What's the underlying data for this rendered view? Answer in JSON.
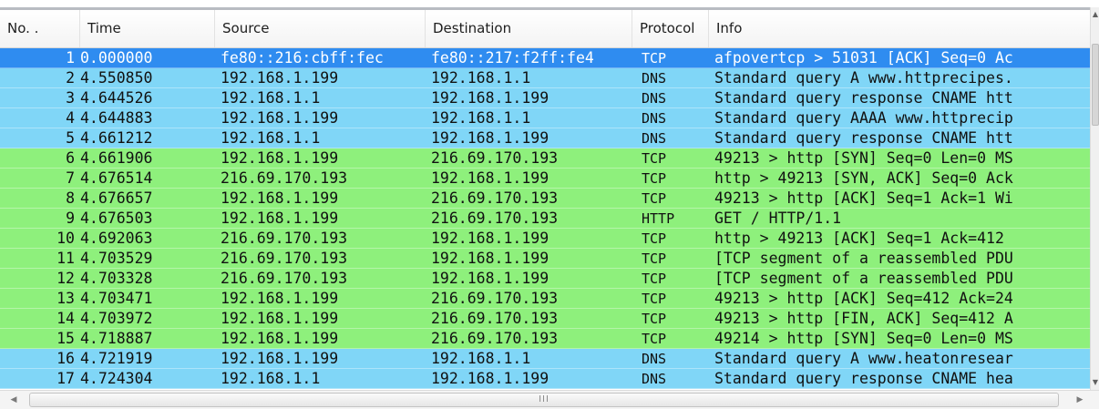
{
  "columns": {
    "no": "No. .",
    "time": "Time",
    "source": "Source",
    "destination": "Destination",
    "protocol": "Protocol",
    "info": "Info"
  },
  "colors": {
    "selected": "#2f8cf0",
    "dns": "#80d6f7",
    "tcp": "#8ef07c",
    "http": "#8ef07c"
  },
  "packets": [
    {
      "no": "1",
      "time": "0.000000",
      "source": "fe80::216:cbff:fec",
      "destination": "fe80::217:f2ff:fe4",
      "protocol": "TCP",
      "info": "afpovertcp > 51031 [ACK] Seq=0 Ac",
      "color": "selected",
      "selected": true
    },
    {
      "no": "2",
      "time": "4.550850",
      "source": "192.168.1.199",
      "destination": "192.168.1.1",
      "protocol": "DNS",
      "info": "Standard query A www.httprecipes.",
      "color": "dns"
    },
    {
      "no": "3",
      "time": "4.644526",
      "source": "192.168.1.1",
      "destination": "192.168.1.199",
      "protocol": "DNS",
      "info": "Standard query response CNAME htt",
      "color": "dns"
    },
    {
      "no": "4",
      "time": "4.644883",
      "source": "192.168.1.199",
      "destination": "192.168.1.1",
      "protocol": "DNS",
      "info": "Standard query AAAA www.httprecip",
      "color": "dns"
    },
    {
      "no": "5",
      "time": "4.661212",
      "source": "192.168.1.1",
      "destination": "192.168.1.199",
      "protocol": "DNS",
      "info": "Standard query response CNAME htt",
      "color": "dns"
    },
    {
      "no": "6",
      "time": "4.661906",
      "source": "192.168.1.199",
      "destination": "216.69.170.193",
      "protocol": "TCP",
      "info": "49213 > http [SYN] Seq=0 Len=0 MS",
      "color": "tcp"
    },
    {
      "no": "7",
      "time": "4.676514",
      "source": "216.69.170.193",
      "destination": "192.168.1.199",
      "protocol": "TCP",
      "info": "http > 49213 [SYN, ACK] Seq=0 Ack",
      "color": "tcp"
    },
    {
      "no": "8",
      "time": "4.676657",
      "source": "192.168.1.199",
      "destination": "216.69.170.193",
      "protocol": "TCP",
      "info": "49213 > http [ACK] Seq=1 Ack=1 Wi",
      "color": "tcp"
    },
    {
      "no": "9",
      "time": "4.676503",
      "source": "192.168.1.199",
      "destination": "216.69.170.193",
      "protocol": "HTTP",
      "info": "GET / HTTP/1.1",
      "color": "http"
    },
    {
      "no": "10",
      "time": "4.692063",
      "source": "216.69.170.193",
      "destination": "192.168.1.199",
      "protocol": "TCP",
      "info": "http > 49213 [ACK] Seq=1 Ack=412",
      "color": "tcp"
    },
    {
      "no": "11",
      "time": "4.703529",
      "source": "216.69.170.193",
      "destination": "192.168.1.199",
      "protocol": "TCP",
      "info": "[TCP segment of a reassembled PDU",
      "color": "tcp"
    },
    {
      "no": "12",
      "time": "4.703328",
      "source": "216.69.170.193",
      "destination": "192.168.1.199",
      "protocol": "TCP",
      "info": "[TCP segment of a reassembled PDU",
      "color": "tcp"
    },
    {
      "no": "13",
      "time": "4.703471",
      "source": "192.168.1.199",
      "destination": "216.69.170.193",
      "protocol": "TCP",
      "info": "49213 > http [ACK] Seq=412 Ack=24",
      "color": "tcp"
    },
    {
      "no": "14",
      "time": "4.703972",
      "source": "192.168.1.199",
      "destination": "216.69.170.193",
      "protocol": "TCP",
      "info": "49213 > http [FIN, ACK] Seq=412 A",
      "color": "tcp"
    },
    {
      "no": "15",
      "time": "4.718887",
      "source": "192.168.1.199",
      "destination": "216.69.170.193",
      "protocol": "TCP",
      "info": "49214 > http [SYN] Seq=0 Len=0 MS",
      "color": "tcp"
    },
    {
      "no": "16",
      "time": "4.721919",
      "source": "192.168.1.199",
      "destination": "192.168.1.1",
      "protocol": "DNS",
      "info": "Standard query A www.heatonresear",
      "color": "dns"
    },
    {
      "no": "17",
      "time": "4.724304",
      "source": "192.168.1.1",
      "destination": "192.168.1.199",
      "protocol": "DNS",
      "info": "Standard query response CNAME hea",
      "color": "dns"
    }
  ],
  "hscroll": {
    "grip": "III"
  },
  "icons": {
    "scroll_up": "up-arrow-icon",
    "scroll_down": "down-arrow-icon",
    "scroll_left": "left-arrow-icon",
    "scroll_right": "right-arrow-icon"
  }
}
